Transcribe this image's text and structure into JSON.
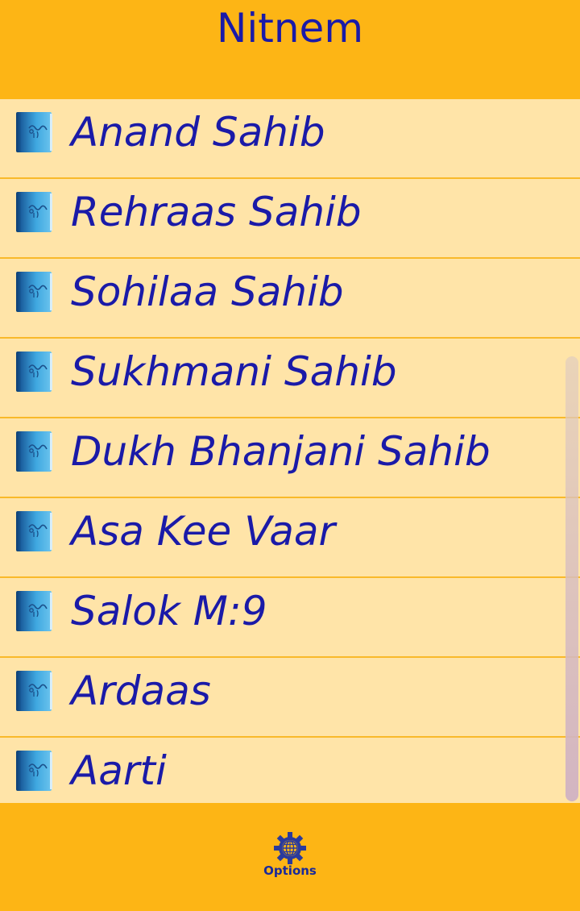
{
  "header": {
    "title": "Nitnem"
  },
  "list": {
    "items": [
      {
        "label": "Anand Sahib",
        "icon": "book-icon"
      },
      {
        "label": "Rehraas Sahib",
        "icon": "book-icon"
      },
      {
        "label": "Sohilaa Sahib",
        "icon": "book-icon"
      },
      {
        "label": "Sukhmani Sahib",
        "icon": "book-icon"
      },
      {
        "label": "Dukh Bhanjani Sahib",
        "icon": "book-icon"
      },
      {
        "label": "Asa Kee Vaar",
        "icon": "book-icon"
      },
      {
        "label": "Salok M:9",
        "icon": "book-icon"
      },
      {
        "label": "Ardaas",
        "icon": "book-icon"
      },
      {
        "label": "Aarti",
        "icon": "book-icon"
      }
    ]
  },
  "footer": {
    "options_label": "Options",
    "options_icon": "gear-globe-icon"
  },
  "colors": {
    "header_bg": "#FDB515",
    "list_bg": "#FFE4A8",
    "divider": "#F9B92A",
    "text": "#1A1AA8"
  }
}
